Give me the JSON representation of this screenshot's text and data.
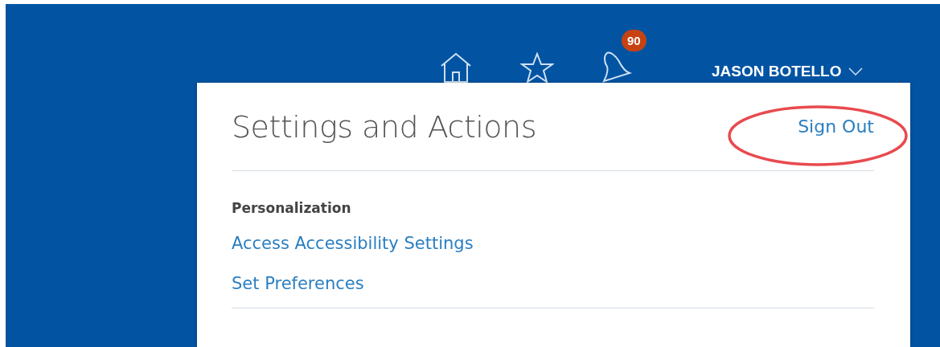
{
  "header": {
    "notifications_badge": "90",
    "user_name": "JASON BOTELLO"
  },
  "panel": {
    "title": "Settings and Actions",
    "sign_out": "Sign Out",
    "sign_out_highlighted": true,
    "sections": [
      {
        "heading": "Personalization",
        "links": [
          "Access Accessibility Settings",
          "Set Preferences"
        ]
      }
    ]
  }
}
